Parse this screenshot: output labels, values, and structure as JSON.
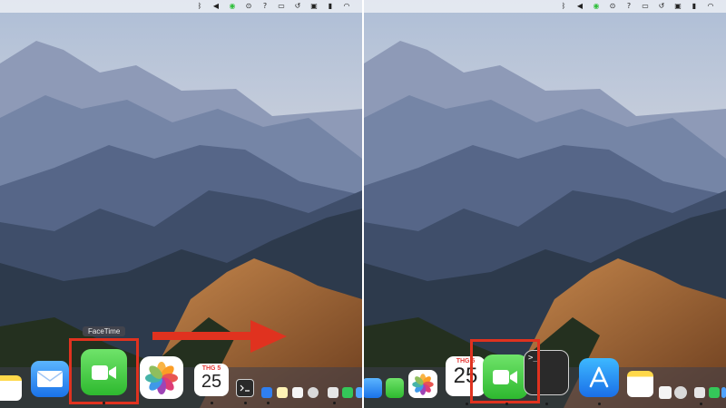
{
  "left_panel": {
    "tooltip": "FaceTime",
    "dock": {
      "calendar": {
        "month": "THG 5",
        "day": "25"
      }
    }
  },
  "right_panel": {
    "dock": {
      "calendar": {
        "month": "THG 5",
        "day": "25"
      },
      "terminal_prompt": ">_"
    }
  },
  "menubar_icons": [
    "bluetooth-icon",
    "volume-icon",
    "grammarly-icon",
    "record-icon",
    "help-icon",
    "display-icon",
    "time-machine-icon",
    "screen-mirror-icon",
    "battery-icon",
    "wifi-icon"
  ],
  "colors": {
    "highlight": "#e0321f",
    "arrow": "#e0321f",
    "facetime_green": "#34c334",
    "calendar_red": "#e53935"
  },
  "annotation": {
    "arrow_direction": "right"
  }
}
